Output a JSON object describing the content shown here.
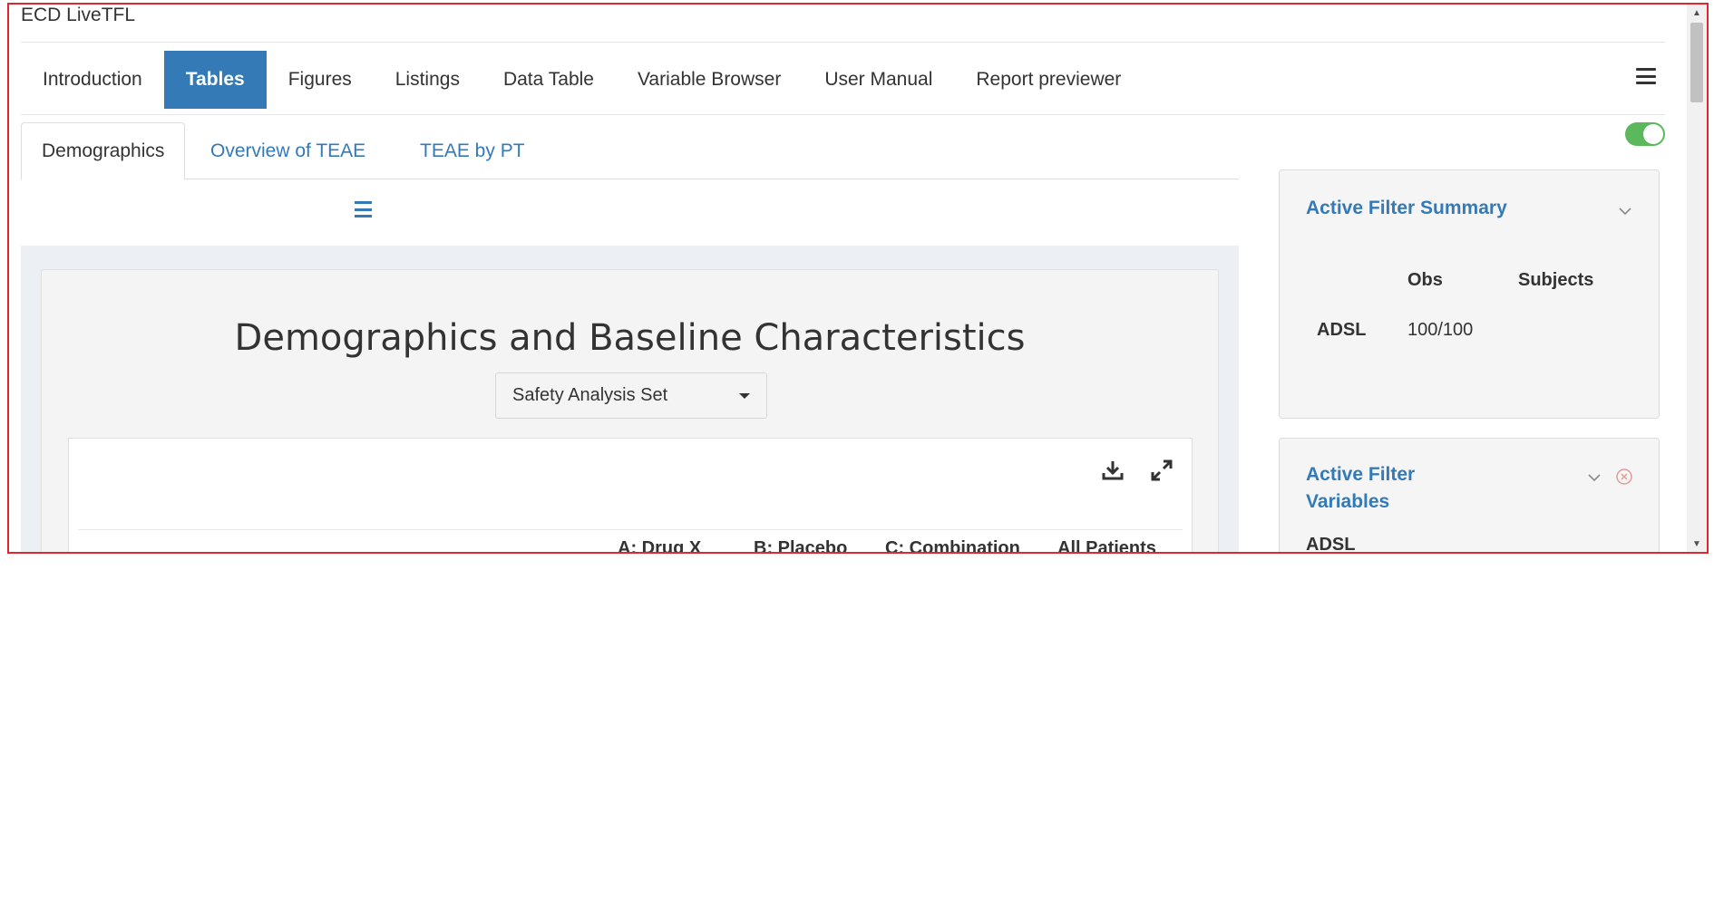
{
  "app": {
    "title": "ECD LiveTFL"
  },
  "nav": {
    "items": [
      {
        "label": "Introduction",
        "active": false
      },
      {
        "label": "Tables",
        "active": true
      },
      {
        "label": "Figures",
        "active": false
      },
      {
        "label": "Listings",
        "active": false
      },
      {
        "label": "Data Table",
        "active": false
      },
      {
        "label": "Variable Browser",
        "active": false
      },
      {
        "label": "User Manual",
        "active": false
      },
      {
        "label": "Report previewer",
        "active": false
      }
    ],
    "menu_icon": "hamburger-icon"
  },
  "toggle": {
    "state": "on",
    "color": "#5cb85c"
  },
  "subtabs": [
    {
      "label": "Demographics",
      "active": true
    },
    {
      "label": "Overview of TEAE",
      "active": false
    },
    {
      "label": "TEAE by PT",
      "active": false
    }
  ],
  "main": {
    "menu_icon": "hamburger-icon",
    "title": "Demographics and Baseline Characteristics",
    "population_select": {
      "value": "Safety Analysis Set"
    },
    "toolbar": {
      "download_icon": "download-icon",
      "expand_icon": "expand-icon"
    },
    "column_headers": [
      "A: Drug X",
      "B: Placebo",
      "C: Combination",
      "All Patients"
    ]
  },
  "filter_summary": {
    "title": "Active Filter Summary",
    "headers": [
      "Obs",
      "Subjects"
    ],
    "rows": [
      {
        "dataset": "ADSL",
        "obs": "100/100",
        "subjects": ""
      }
    ]
  },
  "filter_variables": {
    "title_line1": "Active Filter",
    "title_line2": "Variables",
    "dataset": "ADSL"
  },
  "colors": {
    "accent": "#337ab7",
    "frame": "#e0262f",
    "close": "#d9534f"
  }
}
